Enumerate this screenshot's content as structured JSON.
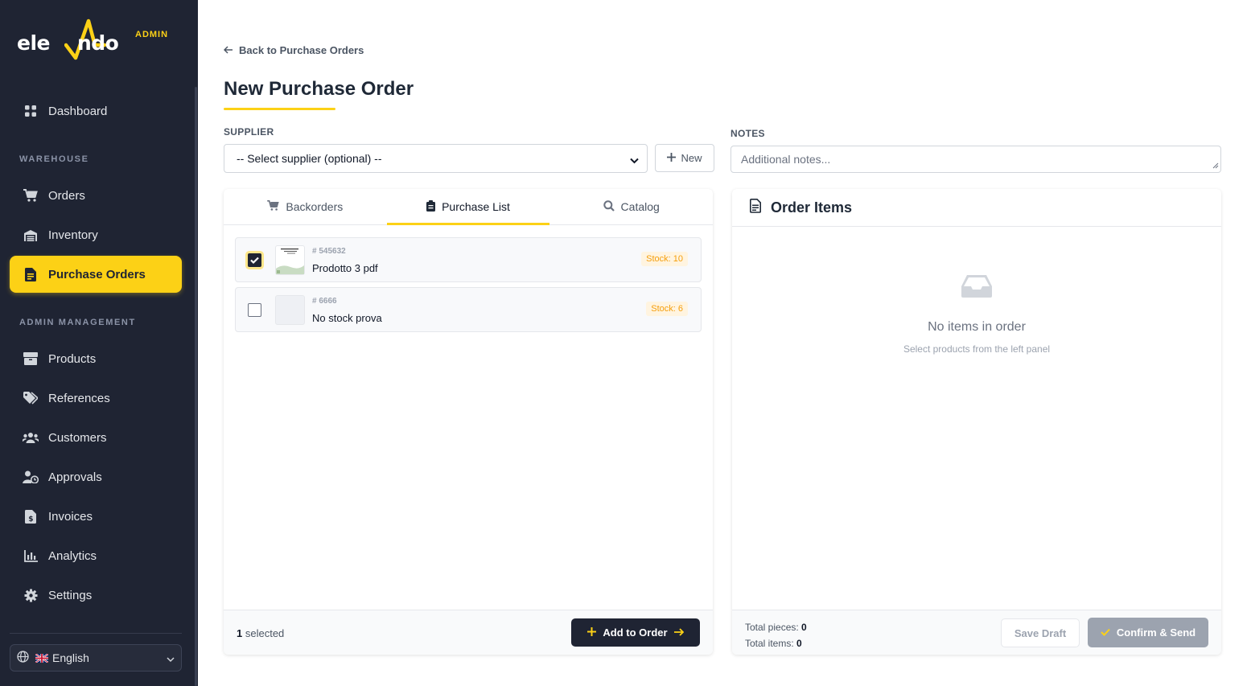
{
  "brand": {
    "name_part1": "ele",
    "name_accent": "vA",
    "name_part2": "ndo",
    "badge": "ADMIN",
    "accent_color": "#fcd116",
    "sidebar_color": "#1f2433"
  },
  "sidebar": {
    "items": [
      {
        "label": "Dashboard",
        "icon": "grid-icon"
      },
      {
        "label": "Orders",
        "icon": "cart-icon"
      },
      {
        "label": "Inventory",
        "icon": "warehouse-icon"
      },
      {
        "label": "Purchase Orders",
        "icon": "file-invoice-icon",
        "active": true
      },
      {
        "label": "Products",
        "icon": "box-icon"
      },
      {
        "label": "References",
        "icon": "tags-icon"
      },
      {
        "label": "Customers",
        "icon": "users-icon"
      },
      {
        "label": "Approvals",
        "icon": "user-clock-icon"
      },
      {
        "label": "Invoices",
        "icon": "invoice-dollar-icon"
      },
      {
        "label": "Analytics",
        "icon": "chart-bar-icon"
      },
      {
        "label": "Settings",
        "icon": "gear-icon"
      }
    ],
    "sections": {
      "warehouse": "WAREHOUSE",
      "admin": "ADMIN MANAGEMENT"
    },
    "language": "English"
  },
  "header": {
    "back_link": "Back to Purchase Orders",
    "title": "New Purchase Order"
  },
  "form": {
    "supplier_label": "SUPPLIER",
    "supplier_value": "-- Select supplier (optional) --",
    "new_button": "New",
    "notes_label": "NOTES",
    "notes_placeholder": "Additional notes..."
  },
  "left_panel": {
    "tabs": [
      {
        "label": "Backorders",
        "icon": "cart-icon"
      },
      {
        "label": "Purchase List",
        "icon": "clipboard-icon",
        "active": true
      },
      {
        "label": "Catalog",
        "icon": "search-icon"
      }
    ],
    "items": [
      {
        "sku": "# 545632",
        "name": "Prodotto 3 pdf",
        "stock": "Stock: 10",
        "checked": true
      },
      {
        "sku": "# 6666",
        "name": "No stock prova",
        "stock": "Stock: 6",
        "checked": false
      }
    ],
    "selected_count": "1",
    "selected_suffix": "selected",
    "add_button": "Add to Order"
  },
  "right_panel": {
    "title": "Order Items",
    "empty_title": "No items in order",
    "empty_subtitle": "Select products from the left panel",
    "total_pieces_label": "Total pieces:",
    "total_pieces": "0",
    "total_items_label": "Total items:",
    "total_items": "0",
    "save_draft": "Save Draft",
    "confirm": "Confirm & Send"
  }
}
